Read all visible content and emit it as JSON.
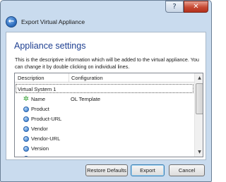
{
  "window": {
    "title": "Export Virtual Appliance",
    "help_glyph": "?",
    "close_glyph": "✕",
    "back_glyph": "←"
  },
  "page": {
    "heading": "Appliance settings",
    "description": "This is the descriptive information which will be added to the virtual appliance. You can change it by double clicking on individual lines."
  },
  "table": {
    "columns": [
      "Description",
      "Configuration"
    ],
    "system_label": "Virtual System 1",
    "rows": [
      {
        "name": "Name",
        "value": "OL Template",
        "icon": "green-star-icon"
      },
      {
        "name": "Product",
        "value": "",
        "icon": "blue-circle-icon"
      },
      {
        "name": "Product-URL",
        "value": "",
        "icon": "blue-circle-icon"
      },
      {
        "name": "Vendor",
        "value": "",
        "icon": "blue-circle-icon"
      },
      {
        "name": "Vendor-URL",
        "value": "",
        "icon": "blue-circle-icon"
      },
      {
        "name": "Version",
        "value": "",
        "icon": "blue-circle-icon"
      }
    ]
  },
  "buttons": {
    "restore": "Restore Defaults",
    "export": "Export",
    "cancel": "Cancel"
  }
}
